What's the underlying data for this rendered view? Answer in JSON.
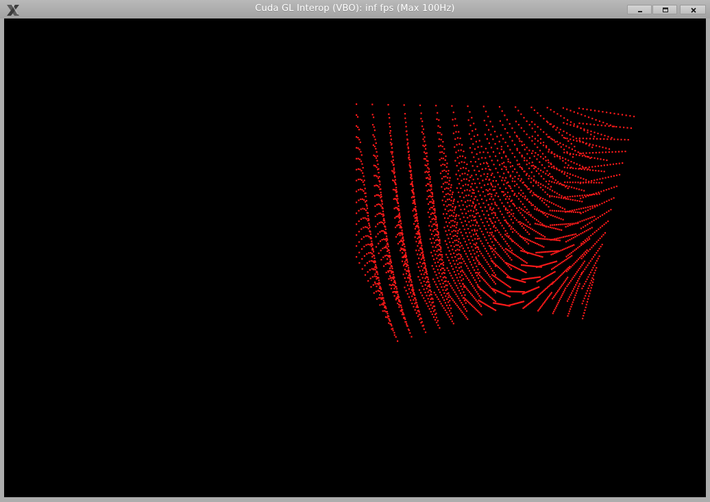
{
  "window": {
    "title": "Cuda GL Interop (VBO): inf fps (Max 100Hz)",
    "buttons": {
      "minimize": "minimize-icon",
      "maximize": "maximize-icon",
      "close": "close-icon"
    },
    "app_icon": "x11-logo-icon"
  },
  "render": {
    "background": "#000000",
    "point_color": "#ff1a1a",
    "object": "point-cloud-cube"
  }
}
